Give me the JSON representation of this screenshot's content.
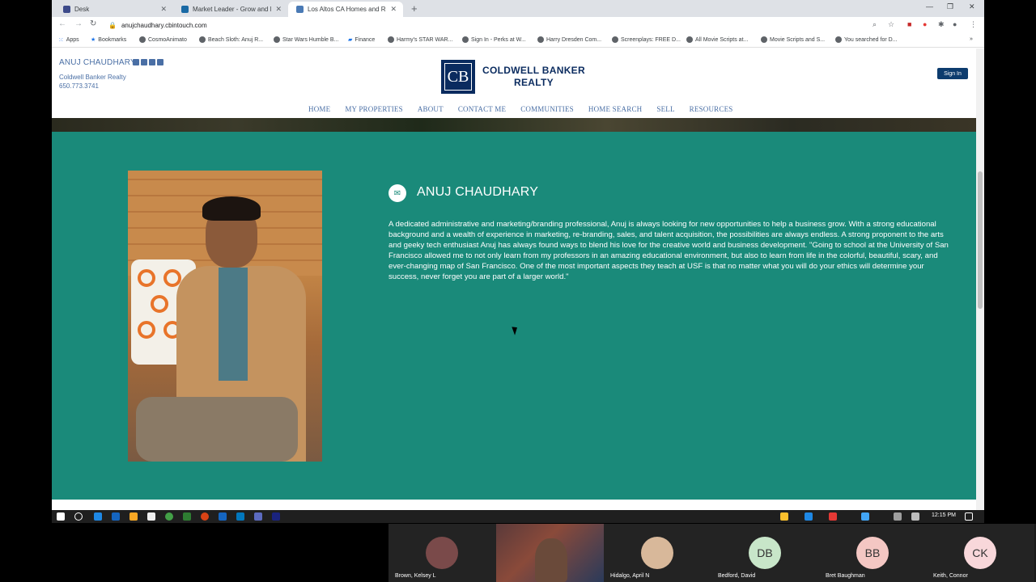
{
  "tabs": [
    {
      "title": "Desk",
      "active": false,
      "color": "#3c4a8a"
    },
    {
      "title": "Market Leader - Grow and Mana",
      "active": false,
      "color": "#1a6aa5"
    },
    {
      "title": "Los Altos CA Homes and Real Est",
      "active": true,
      "color": "#4a7ab5"
    }
  ],
  "toolbar": {
    "url": "anujchaudhary.cbintouch.com"
  },
  "bookmarks": [
    "Apps",
    "Bookmarks",
    "CosmoAnimato",
    "Beach Sloth: Anuj R...",
    "Star Wars Humble B...",
    "Finance",
    "Harmy's STAR WAR...",
    "Sign In - Perks at W...",
    "Harry Dresden Com...",
    "Screenplays: FREE D...",
    "All Movie Scripts at...",
    "Movie Scripts and S...",
    "You searched for D..."
  ],
  "site": {
    "agent_name": "ANUJ CHAUDHARY",
    "company": "Coldwell Banker Realty",
    "phone": "650.773.3741",
    "logo_mark": "CB",
    "logo_line1": "COLDWELL BANKER",
    "logo_line2": "REALTY",
    "signin": "Sign In",
    "nav": [
      "HOME",
      "MY PROPERTIES",
      "ABOUT",
      "CONTACT ME",
      "COMMUNITIES",
      "HOME SEARCH",
      "SELL",
      "RESOURCES"
    ],
    "bio_name": "ANUJ CHAUDHARY",
    "bio": "A dedicated administrative and marketing/branding professional, Anuj is always looking for new opportunities to help a business grow. With a strong educational background and a wealth of experience in marketing, re-branding, sales, and talent acquisition, the possibilities are always endless. A strong proponent to the arts and geeky tech enthusiast Anuj has always found ways to blend his love for the creative world and business development. \"Going to school at the University of San Francisco allowed me to not only learn from my professors in an amazing educational environment, but also to learn from life in the colorful, beautiful, scary, and ever-changing map of San Francisco. One of the most important aspects they teach at USF is that no matter what you will do your ethics will determine your success, never forget you are part of a larger world.\"",
    "accent_color": "#1a8a7a"
  },
  "taskbar": {
    "time": "12:15 PM"
  },
  "meeting": [
    {
      "name": "Brown, Kelsey L",
      "initials": "",
      "color": "#7a4a4a"
    },
    {
      "name": "",
      "initials": "",
      "color": ""
    },
    {
      "name": "Hidalgo, April N",
      "initials": "",
      "color": "#d8b89a"
    },
    {
      "name": "Bedford, David",
      "initials": "DB",
      "color": "#c8e6c9"
    },
    {
      "name": "Bret Baughman",
      "initials": "BB",
      "color": "#f4c7c3"
    },
    {
      "name": "Keith, Connor",
      "initials": "CK",
      "color": "#f8d7da"
    }
  ]
}
